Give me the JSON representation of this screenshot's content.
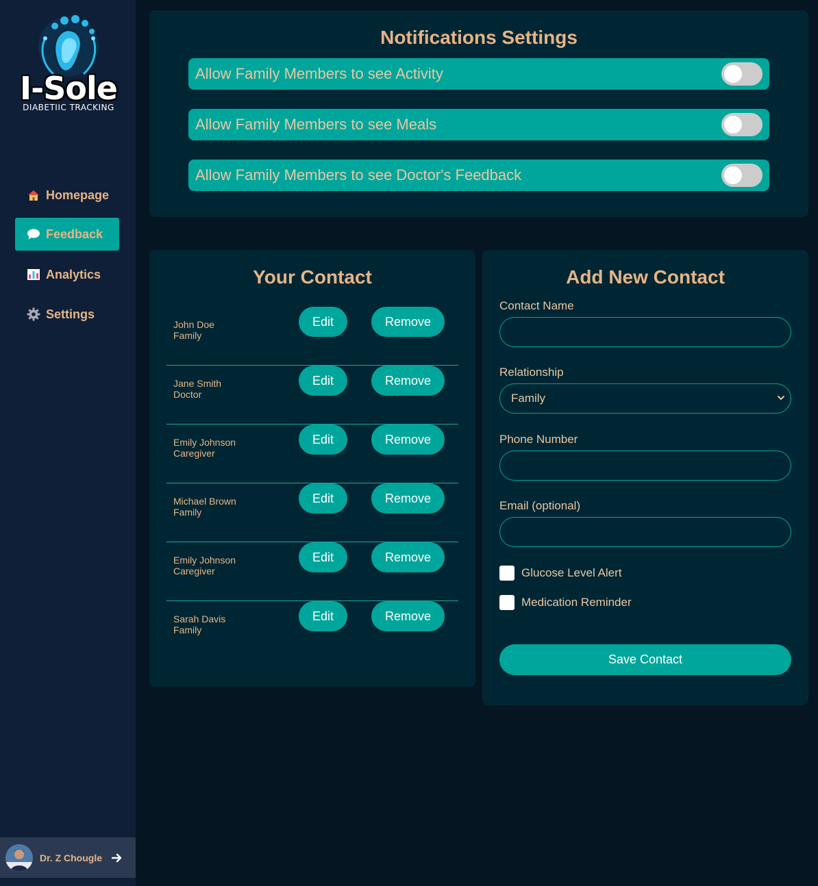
{
  "brand": {
    "name": "I-Sole",
    "tagline": "DIABETIIC TRACKING"
  },
  "nav": [
    {
      "label": "Homepage",
      "icon": "home-icon",
      "active": false
    },
    {
      "label": "Feedback",
      "icon": "speech-bubble-icon",
      "active": true
    },
    {
      "label": "Analytics",
      "icon": "bar-chart-icon",
      "active": false
    },
    {
      "label": "Settings",
      "icon": "gear-icon",
      "active": false
    }
  ],
  "user": {
    "name": "Dr. Z Chougle",
    "logout_icon": "arrow-right-icon"
  },
  "notifications": {
    "title": "Notifications Settings",
    "toggles": [
      {
        "label": "Allow Family Members to see Activity",
        "on": false
      },
      {
        "label": "Allow Family Members to see Meals",
        "on": false
      },
      {
        "label": "Allow Family Members to see Doctor's Feedback",
        "on": false
      }
    ]
  },
  "contacts": {
    "title": "Your Contact",
    "edit_label": "Edit",
    "remove_label": "Remove",
    "items": [
      {
        "name": "John Doe",
        "relationship": "Family"
      },
      {
        "name": "Jane Smith",
        "relationship": "Doctor"
      },
      {
        "name": "Emily Johnson",
        "relationship": "Caregiver"
      },
      {
        "name": "Michael Brown",
        "relationship": "Family"
      },
      {
        "name": "Emily Johnson",
        "relationship": "Caregiver"
      },
      {
        "name": "Sarah Davis",
        "relationship": "Family"
      }
    ]
  },
  "add_contact": {
    "title": "Add New Contact",
    "name_label": "Contact Name",
    "name_value": "",
    "relationship_label": "Relationship",
    "relationship_value": "Family",
    "phone_label": "Phone Number",
    "phone_value": "",
    "email_label": "Email (optional)",
    "email_value": "",
    "glucose_label": "Glucose Level Alert",
    "glucose_checked": false,
    "medication_label": "Medication Reminder",
    "medication_checked": false,
    "save_label": "Save Contact"
  },
  "colors": {
    "accent": "#00a69b",
    "label": "#e6b487",
    "panel": "#012633",
    "sidebar": "#0f1f38",
    "background": "#051522"
  }
}
